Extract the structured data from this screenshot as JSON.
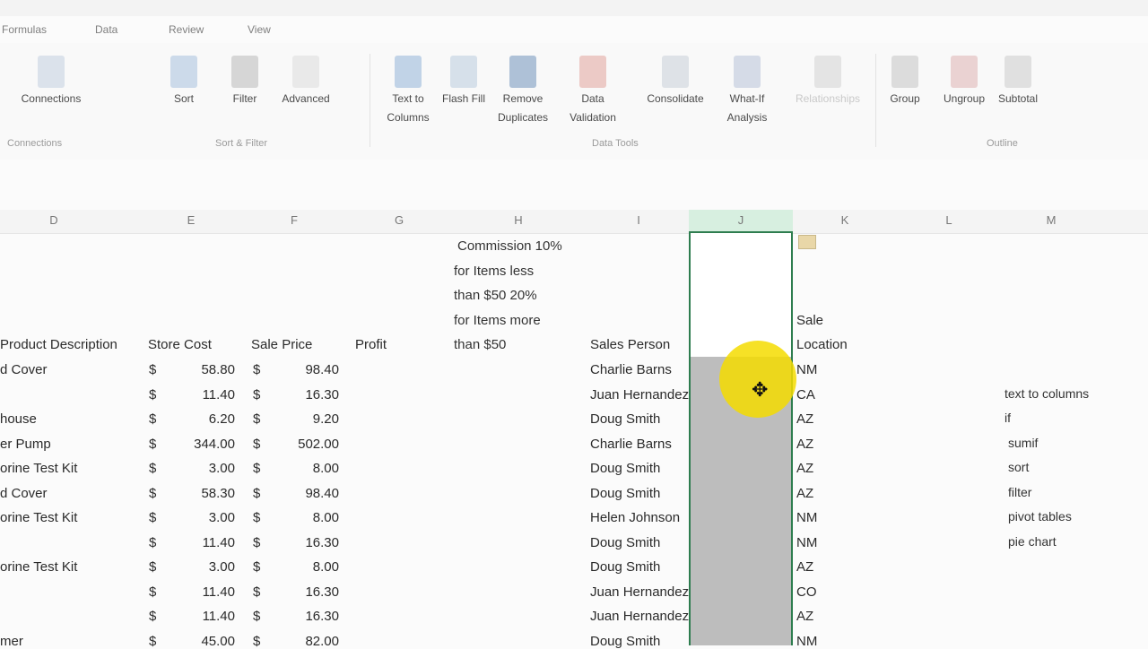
{
  "title_bar": {
    "text": "",
    "color": "#f3f3f3"
  },
  "menu_tabs": [
    {
      "label": "Formulas"
    },
    {
      "label": "Data"
    },
    {
      "label": "Review"
    },
    {
      "label": "View"
    }
  ],
  "ribbon": {
    "buttons": [
      {
        "label": "Connections",
        "icon": "connections-icon"
      },
      {
        "label": "Sort",
        "icon": "sort-icon"
      },
      {
        "label": "Filter",
        "icon": "filter-icon"
      },
      {
        "label": "Advanced",
        "icon": "advanced-filter-icon"
      },
      {
        "label": "Text to Columns",
        "icon": "text-to-columns-icon"
      },
      {
        "label": "Flash Fill",
        "icon": "flash-fill-icon"
      },
      {
        "label": "Remove Duplicates",
        "icon": "remove-duplicates-icon"
      },
      {
        "label": "Data Validation",
        "icon": "data-validation-icon"
      },
      {
        "label": "Consolidate",
        "icon": "consolidate-icon"
      },
      {
        "label": "What-If Analysis",
        "icon": "what-if-icon"
      },
      {
        "label": "Relationships",
        "icon": "relationships-icon"
      },
      {
        "label": "Group",
        "icon": "group-icon"
      },
      {
        "label": "Ungroup",
        "icon": "ungroup-icon"
      },
      {
        "label": "Subtotal",
        "icon": "subtotal-icon"
      }
    ],
    "groups": {
      "connections": "Connections",
      "sort_filter": "Sort & Filter",
      "data_tools": "Data Tools",
      "outline": "Outline"
    }
  },
  "columns": [
    "D",
    "E",
    "F",
    "G",
    "H",
    "I",
    "J",
    "K",
    "L",
    "M"
  ],
  "notes": {
    "commission": "Commission 10%",
    "items_less_1": "for Items less",
    "items_less_2": "than $50  20%",
    "items_more_1": "for Items more",
    "items_more_2": "than $50"
  },
  "headers": {
    "description": "Product Description",
    "store_cost": "Store Cost",
    "sale_price": "Sale Price",
    "profit": "Profit",
    "sales_person": "Sales Person",
    "sale_location_1": "Sale",
    "sale_location_2": "Location"
  },
  "rows": [
    {
      "desc": "d Cover",
      "cost": "58.80",
      "price": "98.40",
      "person": "Charlie Barns",
      "loc": "NM"
    },
    {
      "desc": "",
      "cost": "11.40",
      "price": "16.30",
      "person": "Juan Hernandez",
      "loc": "CA"
    },
    {
      "desc": "house",
      "cost": "6.20",
      "price": "9.20",
      "person": "Doug Smith",
      "loc": "AZ"
    },
    {
      "desc": "er Pump",
      "cost": "344.00",
      "price": "502.00",
      "person": "Charlie Barns",
      "loc": "AZ"
    },
    {
      "desc": "orine Test Kit",
      "cost": "3.00",
      "price": "8.00",
      "person": "Doug Smith",
      "loc": "AZ"
    },
    {
      "desc": "d Cover",
      "cost": "58.30",
      "price": "98.40",
      "person": "Doug Smith",
      "loc": "AZ"
    },
    {
      "desc": "orine Test Kit",
      "cost": "3.00",
      "price": "8.00",
      "person": "Helen Johnson",
      "loc": "NM"
    },
    {
      "desc": "",
      "cost": "11.40",
      "price": "16.30",
      "person": "Doug Smith",
      "loc": "NM"
    },
    {
      "desc": "orine Test Kit",
      "cost": "3.00",
      "price": "8.00",
      "person": "Doug Smith",
      "loc": "AZ"
    },
    {
      "desc": "",
      "cost": "11.40",
      "price": "16.30",
      "person": "Juan Hernandez",
      "loc": "CO"
    },
    {
      "desc": "",
      "cost": "11.40",
      "price": "16.30",
      "person": "Juan Hernandez",
      "loc": "AZ"
    },
    {
      "desc": "mer",
      "cost": "45.00",
      "price": "82.00",
      "person": "Doug Smith",
      "loc": "NM"
    }
  ],
  "currency": "$",
  "todo_list": [
    "text to columns",
    "if",
    "sumif",
    "sort",
    "filter",
    "pivot tables",
    "pie chart"
  ],
  "colors": {
    "selection_border": "#2e7d4f",
    "cursor_highlight": "#f5dc00",
    "selection_fill": "#bdbdbd"
  }
}
